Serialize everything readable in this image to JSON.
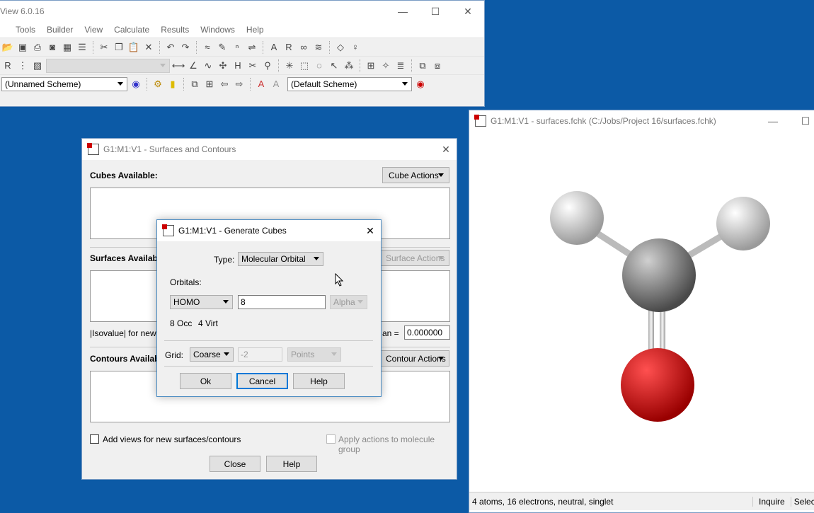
{
  "main_window": {
    "title": "View 6.0.16",
    "menu": [
      "Tools",
      "Builder",
      "View",
      "Calculate",
      "Results",
      "Windows",
      "Help"
    ],
    "toolbar1_icons": [
      "open-icon",
      "save-icon",
      "print-icon",
      "camera-icon",
      "save-image-icon",
      "list-icon",
      "|",
      "cut-icon",
      "copy-icon",
      "paste-icon",
      "delete-icon",
      "|",
      "undo-icon",
      "redo-icon",
      "|",
      "clean-icon",
      "brush-icon",
      "symmetry-icon",
      "connect-icon",
      "|",
      "text-a-icon",
      "text-r-icon",
      "link-icon",
      "layers-icon",
      "|",
      "diamond-icon",
      "pin-icon"
    ],
    "toolbar2_icons": [
      "bond-length-icon",
      "angle-icon",
      "dihedral-icon",
      "select-icon",
      "hydrogen-icon",
      "break-icon",
      "fragment-icon",
      "|",
      "star-icon",
      "box-select-icon",
      "lasso-icon",
      "pointer-icon",
      "atoms-icon",
      "|",
      "add-view-icon",
      "sparkle-icon",
      "list-view-icon",
      "|",
      "copy-view-icon",
      "paste-view-icon"
    ],
    "scheme_left": "(Unnamed Scheme)",
    "scheme_right": "(Default Scheme)"
  },
  "viewer": {
    "title": "G1:M1:V1 - surfaces.fchk (C:/Jobs/Project 16/surfaces.fchk)",
    "status": "4 atoms, 16 electrons, neutral, singlet",
    "inquire": "Inquire",
    "select": "Select",
    "colors": {
      "hydrogen": "#e8e8e8",
      "carbon": "#8c8c8c",
      "oxygen": "#e00000"
    }
  },
  "surfaces_dialog": {
    "title": "G1:M1:V1 - Surfaces and Contours",
    "cubes_label": "Cubes Available:",
    "cube_actions": "Cube Actions",
    "surfaces_label": "Surfaces Availab",
    "surface_actions": "Surface Actions",
    "isovalue_label": "|Isovalue| for new s",
    "an_label": "an =",
    "isovalue": "0.000000",
    "contours_label": "Contours Availab",
    "contour_actions": "Contour Actions",
    "add_views": "Add views for new surfaces/contours",
    "apply_actions": "Apply actions to molecule group",
    "close": "Close",
    "help": "Help"
  },
  "generate_cubes": {
    "title": "G1:M1:V1 - Generate Cubes",
    "type_label": "Type:",
    "type_value": "Molecular Orbital",
    "orbitals_label": "Orbitals:",
    "orbital_select": "HOMO",
    "orbital_value": "8",
    "spin": "Alpha",
    "occ": "8 Occ",
    "virt": "4 Virt",
    "grid_label": "Grid:",
    "grid_value": "Coarse",
    "grid_number": "-2",
    "grid_units": "Points",
    "ok": "Ok",
    "cancel": "Cancel",
    "help": "Help"
  }
}
